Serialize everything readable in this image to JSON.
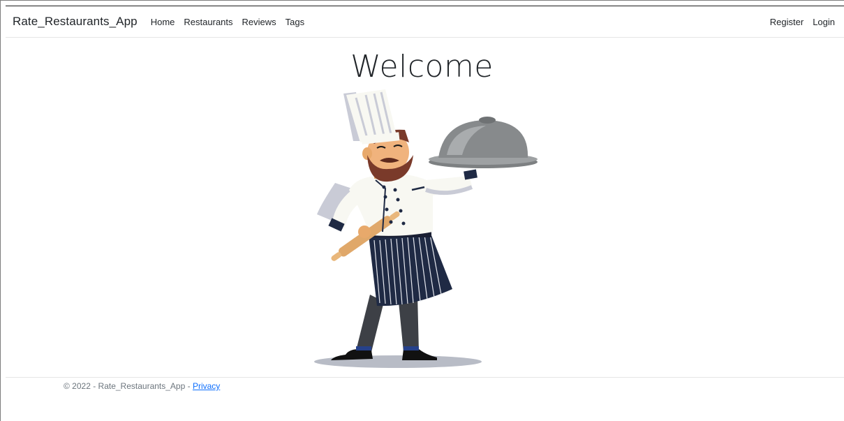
{
  "navbar": {
    "brand": "Rate_Restaurants_App",
    "links": [
      {
        "label": "Home"
      },
      {
        "label": "Restaurants"
      },
      {
        "label": "Reviews"
      },
      {
        "label": "Tags"
      }
    ],
    "right_links": [
      {
        "label": "Register"
      },
      {
        "label": "Login"
      }
    ]
  },
  "main": {
    "title": "Welcome",
    "illustration": "chef-holding-cloche-illustration"
  },
  "footer": {
    "copyright": "© 2022 - Rate_Restaurants_App - ",
    "privacy_label": "Privacy"
  },
  "colors": {
    "text": "#212529",
    "muted": "#6c757d",
    "link": "#0d6efd"
  }
}
